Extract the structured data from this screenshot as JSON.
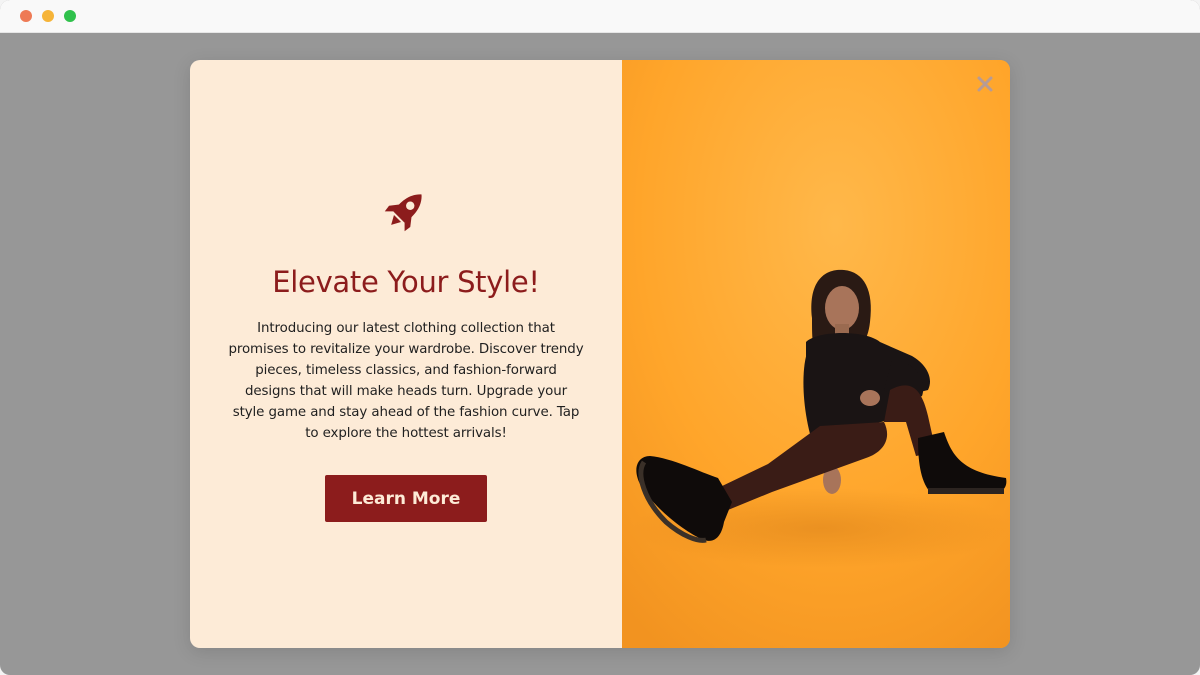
{
  "colors": {
    "overlay": "#979797",
    "titlebar": "#f9f9f9",
    "panel_bg": "#fdebd7",
    "accent": "#8c1c1c",
    "text": "#1f1f1f",
    "button_text": "#fdebd7",
    "photo_bg": "#ffa628",
    "close": "#b69b96",
    "traffic_red": "#ee7a55",
    "traffic_yellow": "#f6b438",
    "traffic_green": "#30c14c"
  },
  "window": {
    "controls": [
      "close-dot",
      "minimize-dot",
      "zoom-dot"
    ]
  },
  "popup": {
    "icon": "rocket-icon",
    "headline": "Elevate Your Style!",
    "body": "Introducing our latest clothing collection that promises to revitalize your wardrobe. Discover trendy pieces, timeless classics, and fashion-forward designs that will make heads turn. Upgrade your style game and stay ahead of the fashion curve. Tap to explore the hottest arrivals!",
    "button_label": "Learn More",
    "close_icon": "close-icon",
    "image": "fashion-model-photo"
  }
}
